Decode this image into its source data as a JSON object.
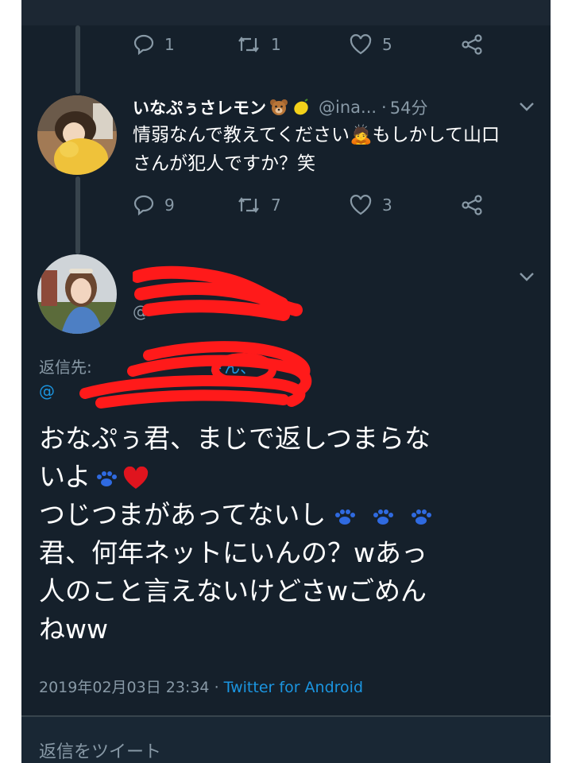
{
  "tweet_prev": {
    "actions": {
      "reply_count": "1",
      "retweet_count": "1",
      "like_count": "5"
    }
  },
  "tweet_reply": {
    "display_name": "いなぷぅさレモン",
    "handle": "@ina...",
    "time": "54分",
    "text": "情弱なんで教えてください🙇もしかして山口さんが犯人ですか？笑",
    "actions": {
      "reply_count": "9",
      "retweet_count": "7",
      "like_count": "3"
    }
  },
  "main_tweet": {
    "replying_label": "返信先:",
    "replying_suffix": "さん、",
    "replying_prefix2": "@",
    "text_line1": "おなぷぅ君、まじで返しつまらな",
    "text_line2": "いよ",
    "text_line3": "つじつまがあってないし",
    "text_line4": "君、何年ネットにいんの？wあっ",
    "text_line5": "人のこと言えないけどさwごめん",
    "text_line6": "ねww",
    "timestamp": "2019年02月03日 23:34",
    "separator": "·",
    "source": "Twitter for Android"
  },
  "reply_composer": {
    "placeholder": "返信をツイート"
  },
  "colors": {
    "background": "#15202b",
    "text": "#ffffff",
    "muted": "#8899a6",
    "link": "#1b95e0",
    "redaction": "#ff1a1a"
  },
  "icons": [
    "reply-icon",
    "retweet-icon",
    "like-icon",
    "share-icon",
    "chevron-down-icon"
  ]
}
